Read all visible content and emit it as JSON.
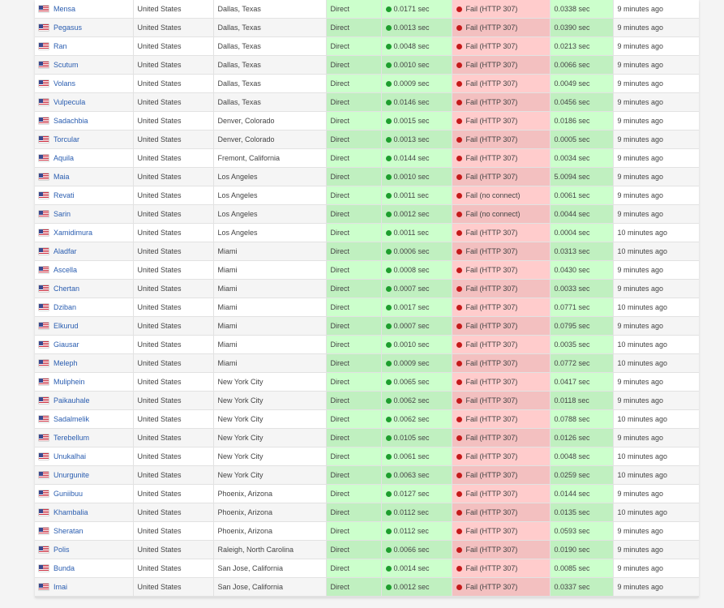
{
  "colors": {
    "ok": "#1e9e2e",
    "fail": "#c51a1a",
    "link": "#2a5db0"
  },
  "rows": [
    {
      "server": "Mensa",
      "country": "United States",
      "location": "Dallas, Texas",
      "method": "Direct",
      "ping": "0.0171 sec",
      "http": "Fail (HTTP 307)",
      "time": "0.0338 sec",
      "checked": "9 minutes ago"
    },
    {
      "server": "Pegasus",
      "country": "United States",
      "location": "Dallas, Texas",
      "method": "Direct",
      "ping": "0.0013 sec",
      "http": "Fail (HTTP 307)",
      "time": "0.0390 sec",
      "checked": "9 minutes ago"
    },
    {
      "server": "Ran",
      "country": "United States",
      "location": "Dallas, Texas",
      "method": "Direct",
      "ping": "0.0048 sec",
      "http": "Fail (HTTP 307)",
      "time": "0.0213 sec",
      "checked": "9 minutes ago"
    },
    {
      "server": "Scutum",
      "country": "United States",
      "location": "Dallas, Texas",
      "method": "Direct",
      "ping": "0.0010 sec",
      "http": "Fail (HTTP 307)",
      "time": "0.0066 sec",
      "checked": "9 minutes ago"
    },
    {
      "server": "Volans",
      "country": "United States",
      "location": "Dallas, Texas",
      "method": "Direct",
      "ping": "0.0009 sec",
      "http": "Fail (HTTP 307)",
      "time": "0.0049 sec",
      "checked": "9 minutes ago"
    },
    {
      "server": "Vulpecula",
      "country": "United States",
      "location": "Dallas, Texas",
      "method": "Direct",
      "ping": "0.0146 sec",
      "http": "Fail (HTTP 307)",
      "time": "0.0456 sec",
      "checked": "9 minutes ago"
    },
    {
      "server": "Sadachbia",
      "country": "United States",
      "location": "Denver, Colorado",
      "method": "Direct",
      "ping": "0.0015 sec",
      "http": "Fail (HTTP 307)",
      "time": "0.0186 sec",
      "checked": "9 minutes ago"
    },
    {
      "server": "Torcular",
      "country": "United States",
      "location": "Denver, Colorado",
      "method": "Direct",
      "ping": "0.0013 sec",
      "http": "Fail (HTTP 307)",
      "time": "0.0005 sec",
      "checked": "9 minutes ago"
    },
    {
      "server": "Aquila",
      "country": "United States",
      "location": "Fremont, California",
      "method": "Direct",
      "ping": "0.0144 sec",
      "http": "Fail (HTTP 307)",
      "time": "0.0034 sec",
      "checked": "9 minutes ago"
    },
    {
      "server": "Maia",
      "country": "United States",
      "location": "Los Angeles",
      "method": "Direct",
      "ping": "0.0010 sec",
      "http": "Fail (HTTP 307)",
      "time": "5.0094 sec",
      "checked": "9 minutes ago"
    },
    {
      "server": "Revati",
      "country": "United States",
      "location": "Los Angeles",
      "method": "Direct",
      "ping": "0.0011 sec",
      "http": "Fail (no connect)",
      "time": "0.0061 sec",
      "checked": "9 minutes ago"
    },
    {
      "server": "Sarin",
      "country": "United States",
      "location": "Los Angeles",
      "method": "Direct",
      "ping": "0.0012 sec",
      "http": "Fail (no connect)",
      "time": "0.0044 sec",
      "checked": "9 minutes ago"
    },
    {
      "server": "Xamidimura",
      "country": "United States",
      "location": "Los Angeles",
      "method": "Direct",
      "ping": "0.0011 sec",
      "http": "Fail (HTTP 307)",
      "time": "0.0004 sec",
      "checked": "10 minutes ago"
    },
    {
      "server": "Aladfar",
      "country": "United States",
      "location": "Miami",
      "method": "Direct",
      "ping": "0.0006 sec",
      "http": "Fail (HTTP 307)",
      "time": "0.0313 sec",
      "checked": "10 minutes ago"
    },
    {
      "server": "Ascella",
      "country": "United States",
      "location": "Miami",
      "method": "Direct",
      "ping": "0.0008 sec",
      "http": "Fail (HTTP 307)",
      "time": "0.0430 sec",
      "checked": "9 minutes ago"
    },
    {
      "server": "Chertan",
      "country": "United States",
      "location": "Miami",
      "method": "Direct",
      "ping": "0.0007 sec",
      "http": "Fail (HTTP 307)",
      "time": "0.0033 sec",
      "checked": "9 minutes ago"
    },
    {
      "server": "Dziban",
      "country": "United States",
      "location": "Miami",
      "method": "Direct",
      "ping": "0.0017 sec",
      "http": "Fail (HTTP 307)",
      "time": "0.0771 sec",
      "checked": "10 minutes ago"
    },
    {
      "server": "Elkurud",
      "country": "United States",
      "location": "Miami",
      "method": "Direct",
      "ping": "0.0007 sec",
      "http": "Fail (HTTP 307)",
      "time": "0.0795 sec",
      "checked": "9 minutes ago"
    },
    {
      "server": "Giausar",
      "country": "United States",
      "location": "Miami",
      "method": "Direct",
      "ping": "0.0010 sec",
      "http": "Fail (HTTP 307)",
      "time": "0.0035 sec",
      "checked": "10 minutes ago"
    },
    {
      "server": "Meleph",
      "country": "United States",
      "location": "Miami",
      "method": "Direct",
      "ping": "0.0009 sec",
      "http": "Fail (HTTP 307)",
      "time": "0.0772 sec",
      "checked": "10 minutes ago"
    },
    {
      "server": "Muliphein",
      "country": "United States",
      "location": "New York City",
      "method": "Direct",
      "ping": "0.0065 sec",
      "http": "Fail (HTTP 307)",
      "time": "0.0417 sec",
      "checked": "9 minutes ago"
    },
    {
      "server": "Paikauhale",
      "country": "United States",
      "location": "New York City",
      "method": "Direct",
      "ping": "0.0062 sec",
      "http": "Fail (HTTP 307)",
      "time": "0.0118 sec",
      "checked": "9 minutes ago"
    },
    {
      "server": "Sadalmelik",
      "country": "United States",
      "location": "New York City",
      "method": "Direct",
      "ping": "0.0062 sec",
      "http": "Fail (HTTP 307)",
      "time": "0.0788 sec",
      "checked": "10 minutes ago"
    },
    {
      "server": "Terebellum",
      "country": "United States",
      "location": "New York City",
      "method": "Direct",
      "ping": "0.0105 sec",
      "http": "Fail (HTTP 307)",
      "time": "0.0126 sec",
      "checked": "9 minutes ago"
    },
    {
      "server": "Unukalhai",
      "country": "United States",
      "location": "New York City",
      "method": "Direct",
      "ping": "0.0061 sec",
      "http": "Fail (HTTP 307)",
      "time": "0.0048 sec",
      "checked": "10 minutes ago"
    },
    {
      "server": "Unurgunite",
      "country": "United States",
      "location": "New York City",
      "method": "Direct",
      "ping": "0.0063 sec",
      "http": "Fail (HTTP 307)",
      "time": "0.0259 sec",
      "checked": "10 minutes ago"
    },
    {
      "server": "Guniibuu",
      "country": "United States",
      "location": "Phoenix, Arizona",
      "method": "Direct",
      "ping": "0.0127 sec",
      "http": "Fail (HTTP 307)",
      "time": "0.0144 sec",
      "checked": "9 minutes ago"
    },
    {
      "server": "Khambalia",
      "country": "United States",
      "location": "Phoenix, Arizona",
      "method": "Direct",
      "ping": "0.0112 sec",
      "http": "Fail (HTTP 307)",
      "time": "0.0135 sec",
      "checked": "10 minutes ago"
    },
    {
      "server": "Sheratan",
      "country": "United States",
      "location": "Phoenix, Arizona",
      "method": "Direct",
      "ping": "0.0112 sec",
      "http": "Fail (HTTP 307)",
      "time": "0.0593 sec",
      "checked": "9 minutes ago"
    },
    {
      "server": "Polis",
      "country": "United States",
      "location": "Raleigh, North Carolina",
      "method": "Direct",
      "ping": "0.0066 sec",
      "http": "Fail (HTTP 307)",
      "time": "0.0190 sec",
      "checked": "9 minutes ago"
    },
    {
      "server": "Bunda",
      "country": "United States",
      "location": "San Jose, California",
      "method": "Direct",
      "ping": "0.0014 sec",
      "http": "Fail (HTTP 307)",
      "time": "0.0085 sec",
      "checked": "9 minutes ago"
    },
    {
      "server": "Imai",
      "country": "United States",
      "location": "San Jose, California",
      "method": "Direct",
      "ping": "0.0012 sec",
      "http": "Fail (HTTP 307)",
      "time": "0.0337 sec",
      "checked": "9 minutes ago"
    }
  ]
}
